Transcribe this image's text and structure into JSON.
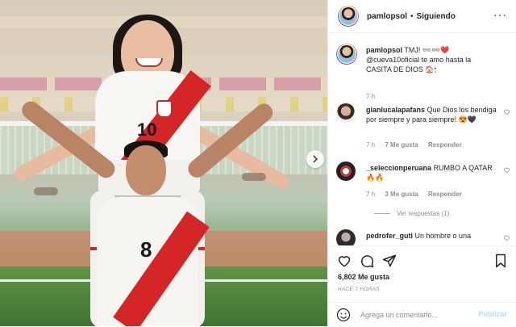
{
  "post": {
    "username": "pamlopsol",
    "follow_dot": "•",
    "follow_state": "Siguiendo",
    "more": "···",
    "photo_jersey_numbers": [
      "10",
      "8"
    ]
  },
  "caption": {
    "username": "pamlopsol",
    "text": "TMJ! 👓👓❤️ @cueva10oficial te amo hasta la CASITA DE DIOS 🏠🕯",
    "time": "7 h"
  },
  "comments": [
    {
      "username": "gianlucalapafans",
      "text": "Que Dios los bendiga por siempre y para siempre! 😍🖤",
      "time": "7 h",
      "likes": "7 Me gusta",
      "reply": "Responder"
    },
    {
      "username": "_seleccionperuana",
      "text": "RUMBO A QATAR🔥🔥",
      "time": "7 h",
      "likes": "3 Me gusta",
      "reply": "Responder",
      "view_replies": "Ver respuestas (1)"
    },
    {
      "username": "pedrofer_guti",
      "text": "Un hombre o una"
    }
  ],
  "engagement": {
    "likes": "6,802 Me gusta",
    "time_ago": "HACE 7 HORAS"
  },
  "composer": {
    "placeholder": "Agrega un comentario...",
    "publish": "Publicar"
  },
  "colors": {
    "sash_red": "#d42527",
    "meta_gray": "#8e8e8e",
    "publish_disabled": "#b2dffc"
  }
}
